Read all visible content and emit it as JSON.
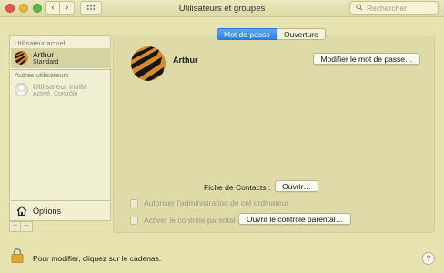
{
  "window": {
    "title": "Utilisateurs et groupes",
    "search_placeholder": "Rechercher"
  },
  "nav": {
    "back_icon": "chevron-left-icon",
    "forward_icon": "chevron-right-icon",
    "grid_icon": "grid-icon"
  },
  "sidebar": {
    "current_user_header": "Utilisateur actuel",
    "current_user": {
      "name": "Arthur",
      "role": "Standard"
    },
    "other_users_header": "Autres utilisateurs",
    "other_users": [
      {
        "name": "Utilisateur invité",
        "status": "Activé, Contrôlé"
      }
    ],
    "options_label": "Options",
    "add_label": "+",
    "remove_label": "−"
  },
  "tabs": [
    {
      "label": "Mot de passe",
      "active": true
    },
    {
      "label": "Ouverture",
      "active": false
    }
  ],
  "user": {
    "full_name": "Arthur",
    "change_password_label": "Modifier le mot de passe…"
  },
  "contacts": {
    "label": "Fiche de Contacts :",
    "open_label": "Ouvrir…"
  },
  "checkboxes": {
    "admin_label": "Autoriser l'administration de cet ordinateur",
    "admin_checked": false,
    "parental_label": "Activer le contrôle parental",
    "parental_checked": false,
    "parental_button_label": "Ouvrir le contrôle parental…"
  },
  "footer": {
    "lock_text": "Pour modifier, cliquez sur le cadenas.",
    "help_label": "?"
  },
  "colors": {
    "background": "#e6e3b0",
    "accent": "#2f7fe8",
    "selection": "#d6d3a3"
  }
}
